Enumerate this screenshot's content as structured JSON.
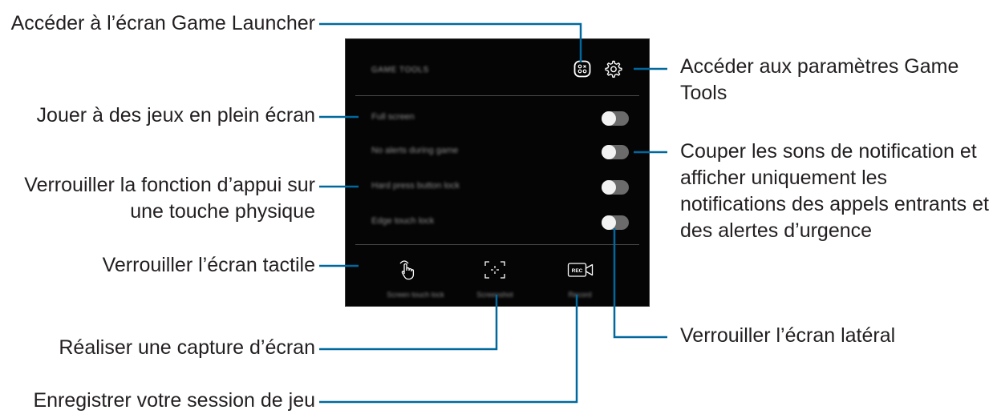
{
  "callouts": {
    "game_launcher": "Accéder à l’écran Game Launcher",
    "settings_line1": "Accéder aux paramètres Game",
    "settings_line2": "Tools",
    "full_screen": "Jouer à des jeux en plein écran",
    "hard_press_line1": "Verrouiller la fonction d’appui sur",
    "hard_press_line2": "une touche physique",
    "no_alerts_line1": "Couper les sons de notification et",
    "no_alerts_line2": "afficher uniquement les",
    "no_alerts_line3": "notifications des appels entrants et",
    "no_alerts_line4": "des alertes d’urgence",
    "touch_lock": "Verrouiller l’écran tactile",
    "edge_lock": "Verrouiller l’écran latéral",
    "screenshot": "Réaliser une capture d’écran",
    "record": "Enregistrer votre session de jeu"
  },
  "panel": {
    "title": "GAME TOOLS",
    "options": [
      {
        "label": "Full screen",
        "on": false
      },
      {
        "label": "No alerts during game",
        "on": false
      },
      {
        "label": "Hard press button lock",
        "on": false
      },
      {
        "label": "Edge touch lock",
        "on": false
      }
    ],
    "buttons": {
      "touch_lock": "Screen touch lock",
      "screenshot": "Screenshot",
      "record": "Record"
    }
  },
  "icons": {
    "launcher": "game-launcher-icon",
    "settings": "gear-icon",
    "touch": "touch-hand-icon",
    "screenshot": "screenshot-frame-icon",
    "record": "rec-camera-icon"
  },
  "colors": {
    "panel_bg": "#050505",
    "leader_line": "#00689d",
    "text": "#231f20"
  }
}
